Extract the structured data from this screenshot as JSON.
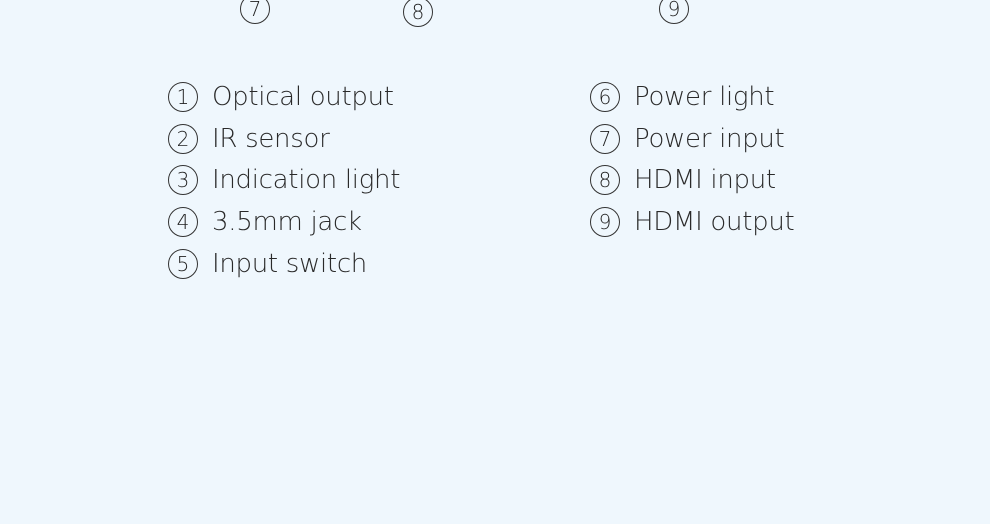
{
  "callouts_top": [
    "7",
    "8",
    "9"
  ],
  "legend": {
    "left": [
      {
        "num": "1",
        "label": "Optical output"
      },
      {
        "num": "2",
        "label": "IR sensor"
      },
      {
        "num": "3",
        "label": "Indication light"
      },
      {
        "num": "4",
        "label": "3.5mm jack"
      },
      {
        "num": "5",
        "label": "Input switch"
      }
    ],
    "right": [
      {
        "num": "6",
        "label": "Power light"
      },
      {
        "num": "7",
        "label": "Power input"
      },
      {
        "num": "8",
        "label": "HDMI input"
      },
      {
        "num": "9",
        "label": "HDMI output"
      }
    ]
  }
}
